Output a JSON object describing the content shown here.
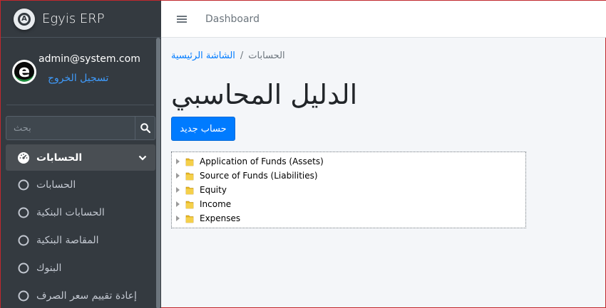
{
  "brand": {
    "name": "Egyis ERP"
  },
  "user": {
    "email": "admin@system.com",
    "logout_label": "تسجيل الخروج"
  },
  "search": {
    "placeholder": "بحث"
  },
  "sidebar": {
    "items": [
      {
        "label": "الحسابات",
        "icon": "tachometer-icon",
        "active": true
      },
      {
        "label": "الحسابات",
        "icon": "circle-icon"
      },
      {
        "label": "الحسابات البنكية",
        "icon": "circle-icon"
      },
      {
        "label": "المقاصة البنكية",
        "icon": "circle-icon"
      },
      {
        "label": "البنوك",
        "icon": "circle-icon"
      },
      {
        "label": "إعادة تقييم سعر الصرف",
        "icon": "circle-icon"
      }
    ]
  },
  "topnav": {
    "dashboard_label": "Dashboard"
  },
  "breadcrumb": {
    "home": "الشاشة الرئيسية",
    "separator": "/",
    "current": "الحسابات"
  },
  "page": {
    "title": "الدليل المحاسبي",
    "new_button": "حساب جديد"
  },
  "tree": {
    "nodes": [
      {
        "label": "Application of Funds (Assets)"
      },
      {
        "label": "Source of Funds (Liabilities)"
      },
      {
        "label": "Equity"
      },
      {
        "label": "Income"
      },
      {
        "label": "Expenses"
      }
    ]
  },
  "colors": {
    "sidebar_bg": "#343a40",
    "primary": "#007bff",
    "content_bg": "#f4f6f9",
    "folder": "#e8b923"
  }
}
